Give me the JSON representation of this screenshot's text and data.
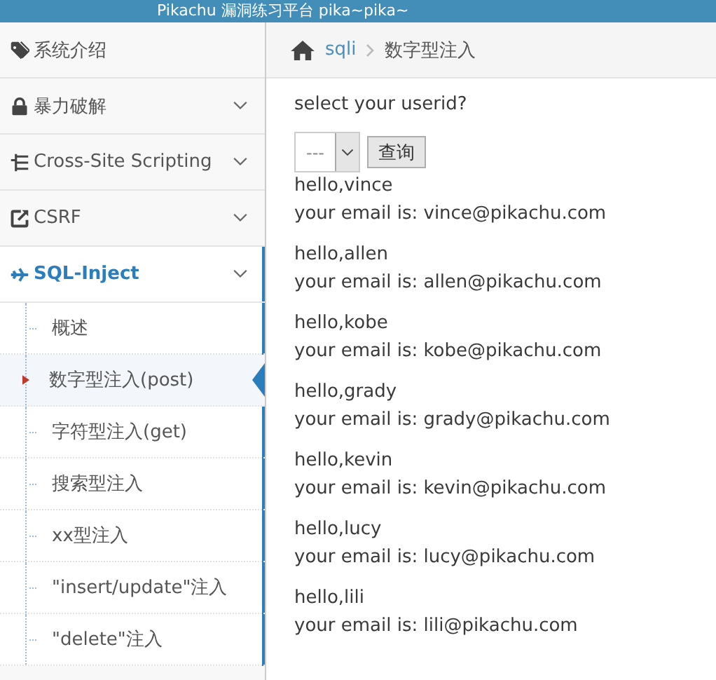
{
  "header": {
    "title": "Pikachu 漏洞练习平台 pika~pika~"
  },
  "sidebar": {
    "items": [
      {
        "label": "系统介绍",
        "expandable": false,
        "selected": false
      },
      {
        "label": "暴力破解",
        "expandable": true,
        "selected": false
      },
      {
        "label": "Cross-Site Scripting",
        "expandable": true,
        "selected": false
      },
      {
        "label": "CSRF",
        "expandable": true,
        "selected": false
      },
      {
        "label": "SQL-Inject",
        "expandable": true,
        "selected": true,
        "children": [
          {
            "label": "概述",
            "selected": false
          },
          {
            "label": "数字型注入(post)",
            "selected": true
          },
          {
            "label": "字符型注入(get)",
            "selected": false
          },
          {
            "label": "搜索型注入",
            "selected": false
          },
          {
            "label": "xx型注入",
            "selected": false
          },
          {
            "label": "\"insert/update\"注入",
            "selected": false
          },
          {
            "label": "\"delete\"注入",
            "selected": false
          }
        ]
      }
    ]
  },
  "breadcrumb": [
    {
      "label": "sqli",
      "link": true
    },
    {
      "label": "数字型注入",
      "link": false
    }
  ],
  "form": {
    "prompt": "select your userid?",
    "select_value": "---",
    "button": "查询"
  },
  "results": [
    {
      "greeting": "hello,vince",
      "email": "your email is: vince@pikachu.com"
    },
    {
      "greeting": "hello,allen",
      "email": "your email is: allen@pikachu.com"
    },
    {
      "greeting": "hello,kobe",
      "email": "your email is: kobe@pikachu.com"
    },
    {
      "greeting": "hello,grady",
      "email": "your email is: grady@pikachu.com"
    },
    {
      "greeting": "hello,kevin",
      "email": "your email is: kevin@pikachu.com"
    },
    {
      "greeting": "hello,lucy",
      "email": "your email is: lucy@pikachu.com"
    },
    {
      "greeting": "hello,lili",
      "email": "your email is: lili@pikachu.com"
    }
  ]
}
